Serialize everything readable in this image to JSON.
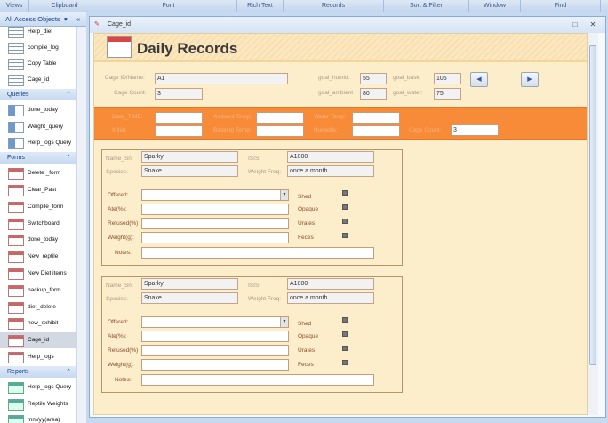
{
  "ribbon": {
    "groups": [
      "Views",
      "Clipboard",
      "Font",
      "Rich Text",
      "Records",
      "Sort & Filter",
      "Window",
      "Find"
    ]
  },
  "nav": {
    "title": "All Access Objects",
    "sections": [
      {
        "name": "",
        "type": "table",
        "items": [
          "Herp_diet",
          "compile_log",
          "Copy Table",
          "Cage_id"
        ]
      },
      {
        "name": "Queries",
        "type": "query",
        "items": [
          "done_today",
          "Weight_query",
          "Herp_logs Query"
        ]
      },
      {
        "name": "Forms",
        "type": "form",
        "items": [
          "Delete _form",
          "Clear_Past",
          "Compile_form",
          "Switchboard",
          "done_today",
          "New_reptile",
          "New Diet items",
          "backup_form",
          "diet_delete",
          "new_exhibit",
          "Cage_id",
          "Herp_logs"
        ]
      },
      {
        "name": "Reports",
        "type": "report",
        "items": [
          "Herp_logs Query",
          "Reptile Weights",
          "mm/yy(area)"
        ]
      }
    ],
    "selected": "Cage_id"
  },
  "window": {
    "title": "Cage_id",
    "minimize": "_",
    "maximize": "□",
    "close": "✕"
  },
  "form": {
    "title": "Daily Records",
    "header": {
      "cage_id_label": "Cage ID/Name:",
      "cage_id": "A1",
      "cage_count_label": "Cage Count:",
      "cage_count": "3",
      "goal_humid_label": "goal_humid:",
      "goal_humid": "55",
      "goal_bask_label": "goal_bask:",
      "goal_bask": "105",
      "goal_ambient_label": "goal_ambient",
      "goal_ambient": "80",
      "goal_water_label": "goal_water:",
      "goal_water": "75",
      "prev": "◀",
      "next": "▶"
    },
    "entry": {
      "date_label": "Date_TIME:",
      "initial_label": "Initial:",
      "ambient_label": "Ambient Temp:",
      "basking_label": "Basking Temp:",
      "water_label": "Water Temp:",
      "humidity_label": "Humidity:",
      "cage_count_label": "Cage Count:",
      "cage_count": "3"
    },
    "records": [
      {
        "name_label": "Name_Sn:",
        "name": "Sparky",
        "isis_label": "ISIS:",
        "isis": "A1000",
        "species_label": "Species:",
        "species": "Snake",
        "wf_label": "Weight Freq:",
        "wf": "once a month",
        "offered": "Offered:",
        "ate": "Ate(%):",
        "refused": "Refused(%)",
        "weight": "Weight(g):",
        "notes": "Notes:",
        "shed": "Shed",
        "opaque": "Opaque",
        "urates": "Urates",
        "feces": "Feces"
      },
      {
        "name_label": "Name_Sn:",
        "name": "Sparky",
        "isis_label": "ISIS:",
        "isis": "A1000",
        "species_label": "Species:",
        "species": "Snake",
        "wf_label": "Weight Freq:",
        "wf": "once a month",
        "offered": "Offered:",
        "ate": "Ate(%):",
        "refused": "Refused(%)",
        "weight": "Weight(g):",
        "notes": "Notes:",
        "shed": "Shed",
        "opaque": "Opaque",
        "urates": "Urates",
        "feces": "Feces"
      }
    ]
  }
}
